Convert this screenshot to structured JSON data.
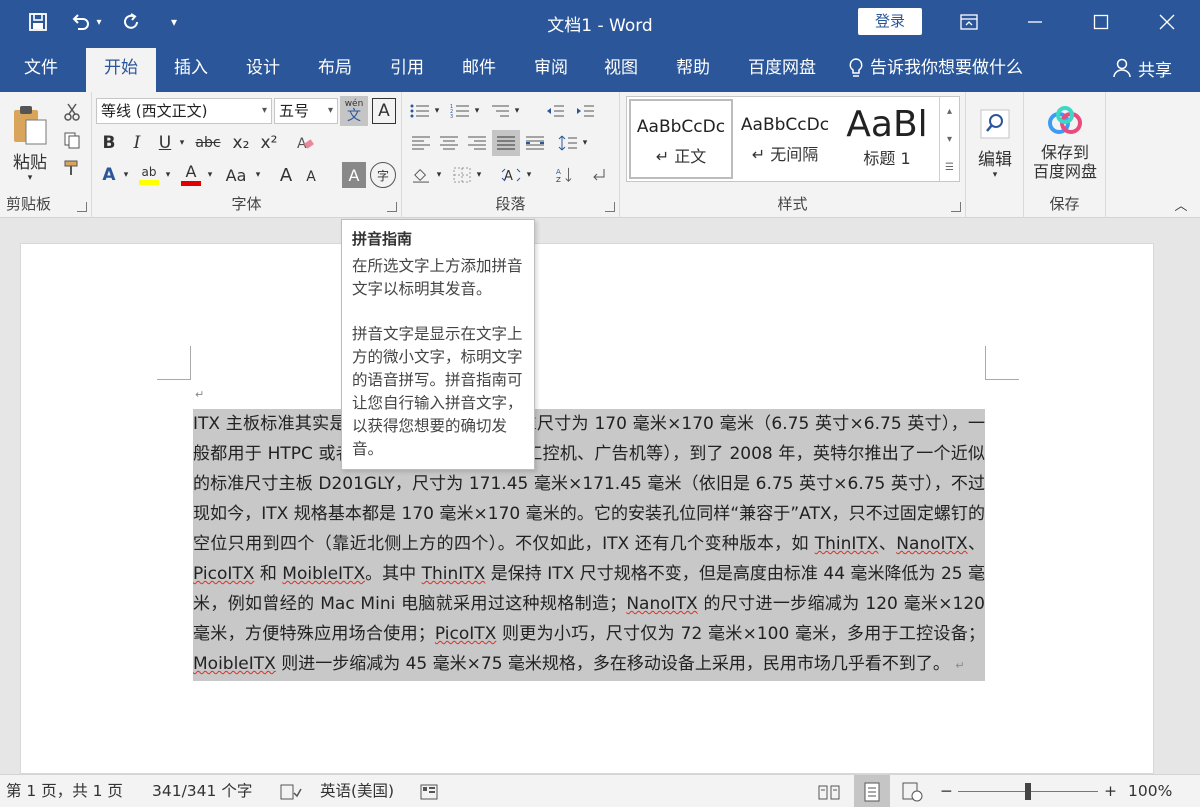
{
  "titlebar": {
    "doc_title": "文档1  -  Word",
    "login_label": "登录",
    "icons": [
      "save-icon",
      "undo-icon",
      "redo-icon",
      "customize-qat-icon",
      "ribbon-display-icon",
      "minimize-icon",
      "maximize-icon",
      "close-icon"
    ]
  },
  "tabs": {
    "items": [
      "文件",
      "开始",
      "插入",
      "设计",
      "布局",
      "引用",
      "邮件",
      "审阅",
      "视图",
      "帮助",
      "百度网盘"
    ],
    "active": "开始",
    "tell_me": "告诉我你想要做什么",
    "share": "共享"
  },
  "ribbon": {
    "clipboard": {
      "paste": "粘贴",
      "label": "剪贴板"
    },
    "font": {
      "name": "等线 (西文正文)",
      "size": "五号",
      "phonetic_top": "wén",
      "phonetic_bottom": "文",
      "border_char": "A",
      "bold": "B",
      "italic": "I",
      "underline": "U",
      "strike": "abc",
      "sub": "x₂",
      "sup": "x²",
      "effects": "A",
      "highlight": "ab",
      "color": "A",
      "case": "Aa",
      "grow": "A",
      "shrink": "A",
      "shading": "A",
      "enclose": "字",
      "label": "字体"
    },
    "paragraph": {
      "label": "段落"
    },
    "styles": {
      "label": "样式",
      "items": [
        {
          "sample": "AaBbCcDc",
          "name": "↵ 正文"
        },
        {
          "sample": "AaBbCcDc",
          "name": "↵ 无间隔"
        },
        {
          "sample": "AaBl",
          "name": "标题 1"
        }
      ]
    },
    "editing": {
      "label": "编辑"
    },
    "save": {
      "line1": "保存到",
      "line2": "百度网盘",
      "label": "保存"
    }
  },
  "tooltip": {
    "title": "拼音指南",
    "line1": "在所选文字上方添加拼音文字以标明其发音。",
    "line2": "拼音文字是显示在文字上方的微小文字，标明文字的语音拼写。拼音指南可让您自行输入拼音文字，以获得您想要的确切发音。"
  },
  "document": {
    "t1": "ITX 主板标准其实是由威盛定义的，它的标准尺寸为 170 毫米×170 毫米（6.75 英寸×6.75 英寸），一般都用于 HTPC 或者是特殊设备里的电脑（工控机、广告机等），到了 2008 年，英特尔推出了一个近似的标准尺寸主板 D201GLY，尺寸为 171.45 毫米×171.45 毫米（依旧是 6.75 英寸×6.75 英寸），不过现如今，ITX 规格基本都是 170 毫米×170 毫米的。它的安装孔位同样“兼容于”ATX，只不过固定螺钉的空位只用到四个（靠近北侧上方的四个）。不仅如此，ITX 还有几个变种版本，如 ",
    "w1": "ThinITX",
    "s1": "、",
    "w2": "NanoITX",
    "s2": "、",
    "w3": "PicoITX",
    "s3": " 和 ",
    "w4": "MoibleITX",
    "s4": "。其中 ",
    "w5": "ThinITX",
    "t2": " 是保持 ITX 尺寸规格不变，但是高度由标准 44 毫米降低为 25 毫米，例如曾经的 Mac Mini 电脑就采用过这种规格制造；",
    "w6": "NanoITX",
    "t3": " 的尺寸进一步缩减为 120 毫米×120 毫米，方便特殊应用场合使用；",
    "w7": "PicoITX",
    "t4": " 则更为小巧，尺寸仅为 72 毫米×100 毫米，多用于工控设备；",
    "w8": "MoibleITX",
    "t5": " 则进一步缩减为 45 毫米×75 毫米规格，多在移动设备上采用，民用市场几乎看不到了。",
    "pmark_empty": "↵",
    "pmark_end": "↵"
  },
  "statusbar": {
    "page": "第 1 页，共 1 页",
    "words": "341/341 个字",
    "language": "英语(美国)",
    "zoom": "100%",
    "zoom_minus": "−",
    "zoom_plus": "+",
    "zoom_fraction": 0.5
  },
  "colors": {
    "word_blue": "#2b579a",
    "ribbon_bg": "#f3f3f3",
    "selection": "#c8c8c8",
    "highlight_yellow": "#ffff00",
    "font_red": "#e00000"
  }
}
